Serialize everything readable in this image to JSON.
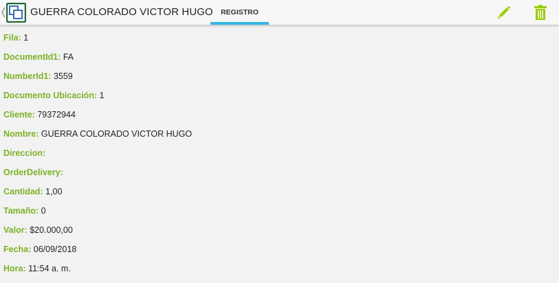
{
  "header": {
    "title": "GUERRA COLORADO VICTOR HUGO",
    "icons": {
      "back": "chevron-left-icon",
      "app": "app-logo-icon",
      "edit": "pencil-icon",
      "delete": "trash-icon"
    }
  },
  "tabs": [
    {
      "label": "REGISTRO",
      "selected": true
    }
  ],
  "colors": {
    "label_green": "#7cb227",
    "tab_indicator": "#33b5e5",
    "action_icon_green": "#99cc00",
    "app_icon_green": "#1e6b33"
  },
  "fields": [
    {
      "label": "Fila:",
      "value": "1"
    },
    {
      "label": "DocumentId1:",
      "value": "FA"
    },
    {
      "label": "NumberId1:",
      "value": "3559"
    },
    {
      "label": "Documento Ubicación:",
      "value": "1"
    },
    {
      "label": "Cliente:",
      "value": "79372944"
    },
    {
      "label": "Nombre:",
      "value": "GUERRA COLORADO VICTOR HUGO"
    },
    {
      "label": "Direccion:",
      "value": ""
    },
    {
      "label": "OrderDelivery:",
      "value": ""
    },
    {
      "label": "Cantidad:",
      "value": "1,00"
    },
    {
      "label": "Tamaño:",
      "value": "0"
    },
    {
      "label": "Valor:",
      "value": "$20.000,00"
    },
    {
      "label": "Fecha:",
      "value": "06/09/2018"
    },
    {
      "label": "Hora:",
      "value": "11:54 a. m."
    }
  ]
}
